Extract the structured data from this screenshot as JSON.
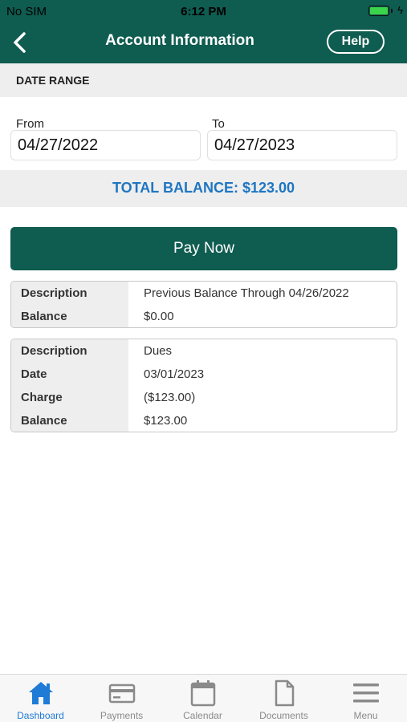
{
  "status_bar": {
    "carrier": "No SIM",
    "time": "6:12 PM",
    "battery_level": 1.0,
    "charge_glyph": "ϟ"
  },
  "nav": {
    "title": "Account Information",
    "help_label": "Help",
    "back_icon": "chevron-left-icon"
  },
  "date_range": {
    "header": "DATE RANGE",
    "from_label": "From",
    "from_value": "04/27/2022",
    "to_label": "To",
    "to_value": "04/27/2023"
  },
  "total_balance": "TOTAL BALANCE: $123.00",
  "pay_now_label": "Pay Now",
  "records": [
    {
      "rows": [
        {
          "label": "Description",
          "value": "Previous Balance Through 04/26/2022"
        },
        {
          "label": "Balance",
          "value": "$0.00"
        }
      ]
    },
    {
      "rows": [
        {
          "label": "Description",
          "value": "Dues"
        },
        {
          "label": "Date",
          "value": "03/01/2023"
        },
        {
          "label": "Charge",
          "value": "($123.00)"
        },
        {
          "label": "Balance",
          "value": "$123.00"
        }
      ]
    }
  ],
  "tabs": [
    {
      "label": "Dashboard",
      "icon": "home-icon",
      "active": true
    },
    {
      "label": "Payments",
      "icon": "credit-card-icon",
      "active": false
    },
    {
      "label": "Calendar",
      "icon": "calendar-icon",
      "active": false
    },
    {
      "label": "Documents",
      "icon": "document-icon",
      "active": false
    },
    {
      "label": "Menu",
      "icon": "menu-icon",
      "active": false
    }
  ],
  "colors": {
    "brand": "#0f5c50",
    "accent_blue": "#1f76c2",
    "tab_active": "#1f7bd6",
    "tab_inactive": "#8a8a8a",
    "section_bg": "#eeeeee"
  }
}
